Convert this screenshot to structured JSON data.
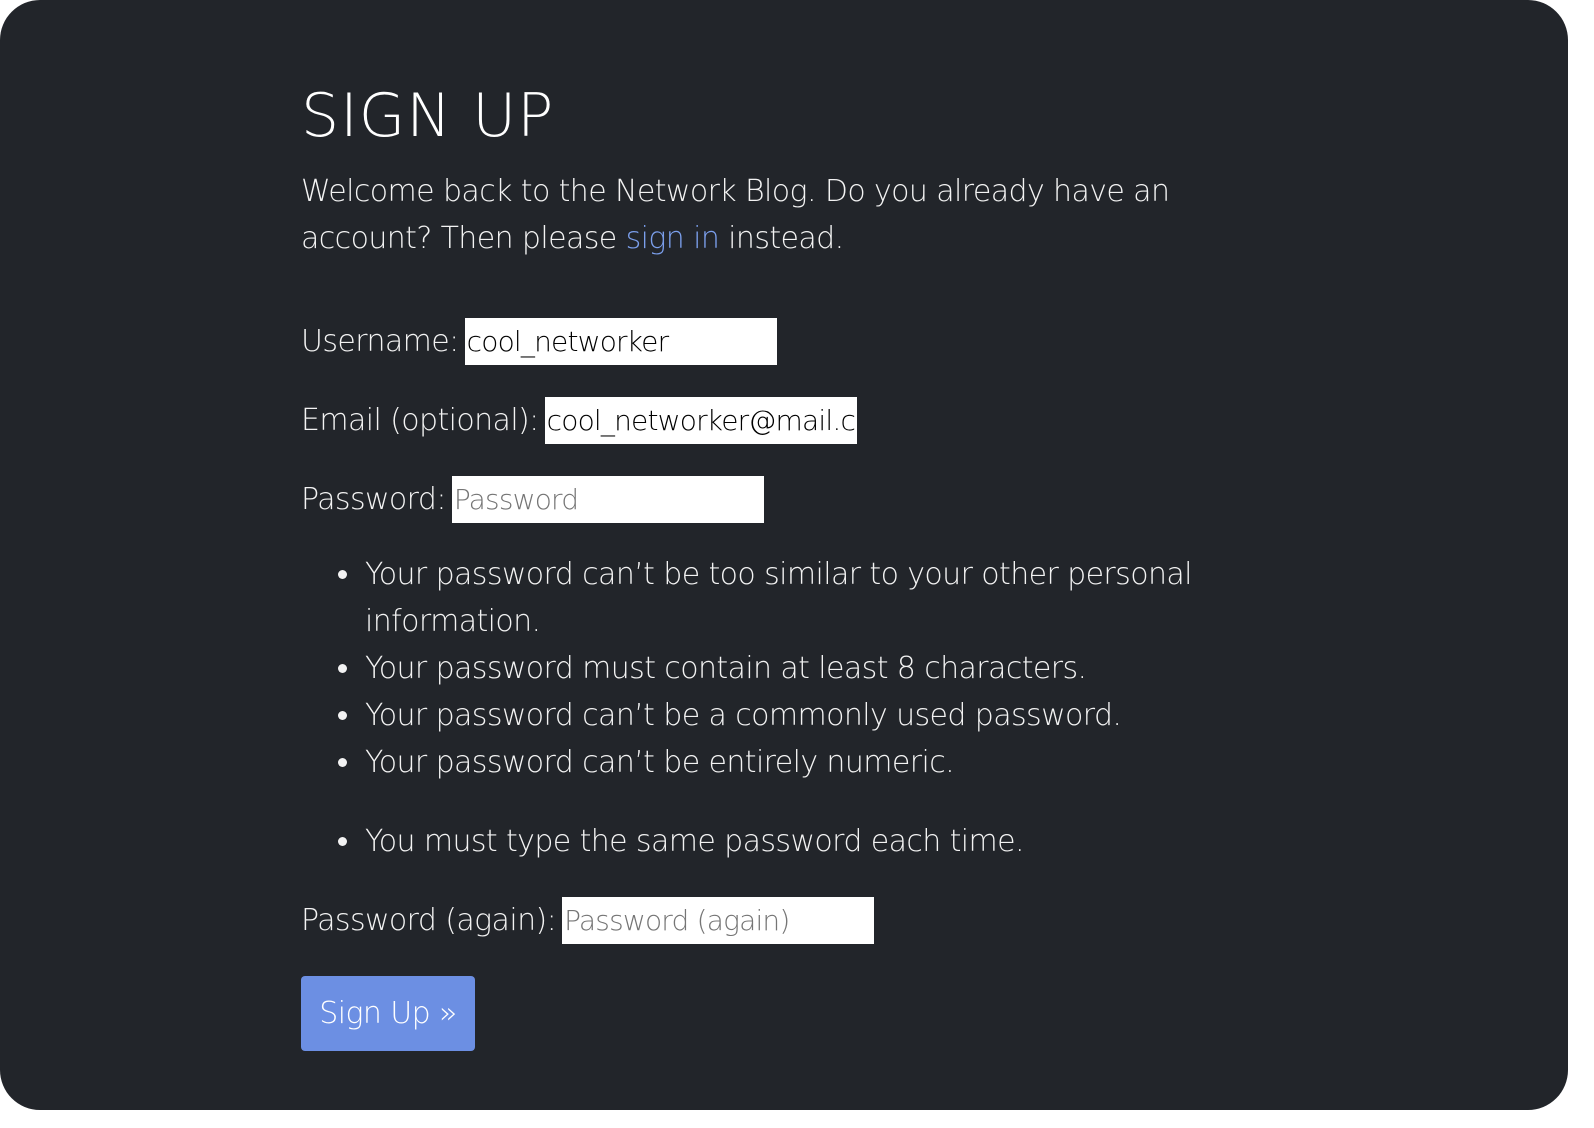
{
  "page": {
    "title": "SIGN UP",
    "intro_prefix": "Welcome back to the Network Blog. Do you already have an account? Then please ",
    "intro_link": "sign in",
    "intro_suffix": " instead."
  },
  "form": {
    "username_label": "Username:",
    "username_value": "cool_networker",
    "email_label": "Email (optional):",
    "email_value": "cool_networker@mail.com",
    "password_label": "Password:",
    "password_placeholder": "Password",
    "password_help": [
      "Your password can’t be too similar to your other personal information.",
      "Your password must contain at least 8 characters.",
      "Your password can’t be a commonly used password.",
      "Your password can’t be entirely numeric."
    ],
    "password2_help": [
      "You must type the same password each time."
    ],
    "password2_label": "Password (again):",
    "password2_placeholder": "Password (again)",
    "submit_label": "Sign Up »"
  },
  "colors": {
    "background": "#22252a",
    "link": "#7b9fec",
    "button": "#6c8fe3",
    "text": "#f3f3f3"
  }
}
